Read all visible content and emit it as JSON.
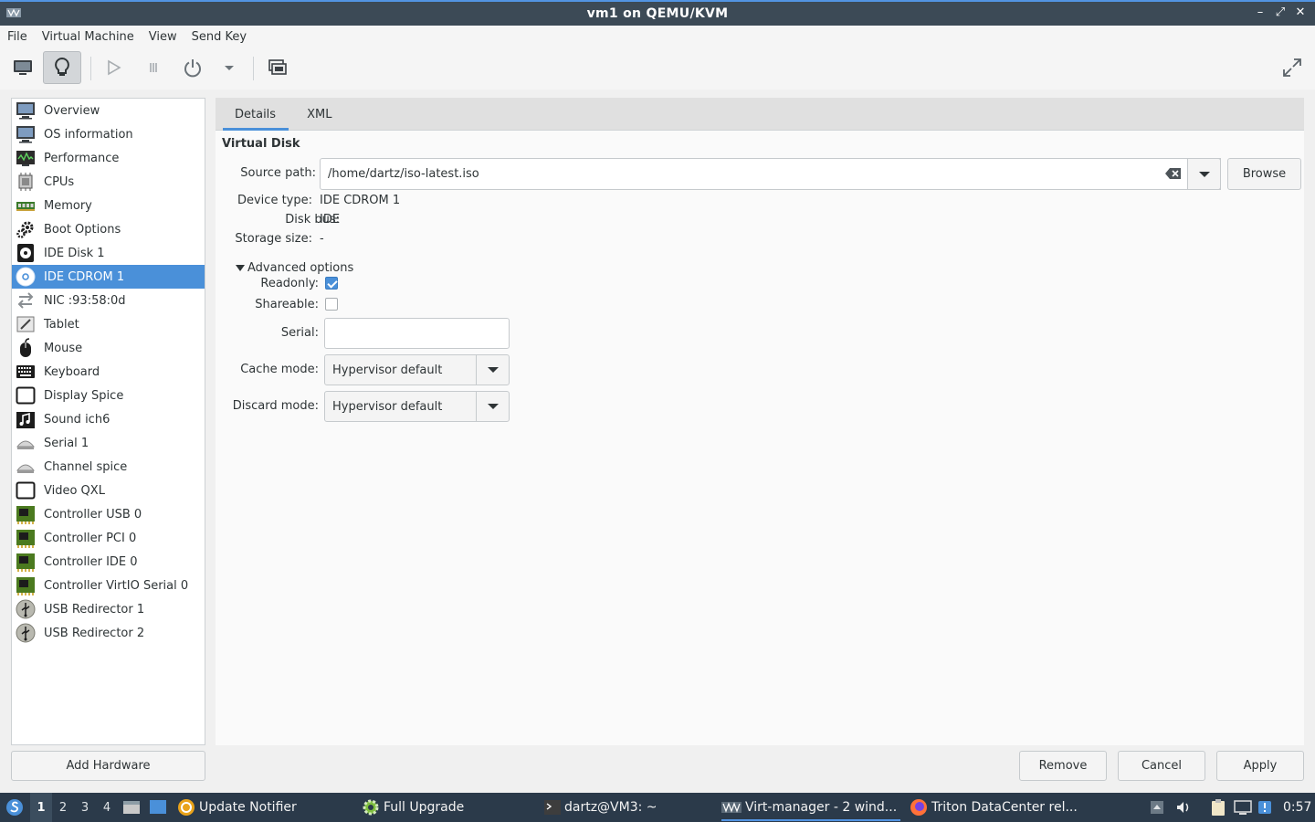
{
  "window": {
    "title": "vm1 on QEMU/KVM"
  },
  "menu": [
    "File",
    "Virtual Machine",
    "View",
    "Send Key"
  ],
  "sidebar": {
    "items": [
      {
        "label": "Overview",
        "icon": "monitor-icon"
      },
      {
        "label": "OS information",
        "icon": "monitor-icon"
      },
      {
        "label": "Performance",
        "icon": "performance-icon"
      },
      {
        "label": "CPUs",
        "icon": "cpu-icon"
      },
      {
        "label": "Memory",
        "icon": "memory-icon"
      },
      {
        "label": "Boot Options",
        "icon": "gears-icon"
      },
      {
        "label": "IDE Disk 1",
        "icon": "disk-icon"
      },
      {
        "label": "IDE CDROM 1",
        "icon": "cdrom-icon",
        "selected": true
      },
      {
        "label": "NIC :93:58:0d",
        "icon": "network-icon"
      },
      {
        "label": "Tablet",
        "icon": "tablet-icon"
      },
      {
        "label": "Mouse",
        "icon": "mouse-icon"
      },
      {
        "label": "Keyboard",
        "icon": "keyboard-icon"
      },
      {
        "label": "Display Spice",
        "icon": "display-icon"
      },
      {
        "label": "Sound ich6",
        "icon": "sound-icon"
      },
      {
        "label": "Serial 1",
        "icon": "serial-icon"
      },
      {
        "label": "Channel spice",
        "icon": "serial-icon"
      },
      {
        "label": "Video QXL",
        "icon": "display-icon"
      },
      {
        "label": "Controller USB 0",
        "icon": "controller-icon"
      },
      {
        "label": "Controller PCI 0",
        "icon": "controller-icon"
      },
      {
        "label": "Controller IDE 0",
        "icon": "controller-icon"
      },
      {
        "label": "Controller VirtIO Serial 0",
        "icon": "controller-icon"
      },
      {
        "label": "USB Redirector 1",
        "icon": "usb-icon"
      },
      {
        "label": "USB Redirector 2",
        "icon": "usb-icon"
      }
    ],
    "add_hardware": "Add Hardware"
  },
  "tabs": [
    "Details",
    "XML"
  ],
  "details": {
    "section_title": "Virtual Disk",
    "source_path_label": "Source path:",
    "source_path_value": "/home/dartz/iso-latest.iso",
    "browse": "Browse",
    "device_type_label": "Device type:",
    "device_type_value": "IDE CDROM 1",
    "disk_bus_label": "Disk bus:",
    "disk_bus_value": "IDE",
    "storage_size_label": "Storage size:",
    "storage_size_value": "-",
    "advanced_label": "Advanced options",
    "readonly_label": "Readonly:",
    "readonly_checked": true,
    "shareable_label": "Shareable:",
    "shareable_checked": false,
    "serial_label": "Serial:",
    "serial_value": "",
    "cache_mode_label": "Cache mode:",
    "cache_mode_value": "Hypervisor default",
    "discard_mode_label": "Discard mode:",
    "discard_mode_value": "Hypervisor default"
  },
  "buttons": {
    "remove": "Remove",
    "cancel": "Cancel",
    "apply": "Apply"
  },
  "taskbar": {
    "workspaces": [
      "1",
      "2",
      "3",
      "4"
    ],
    "current_workspace": "1",
    "tasks": [
      {
        "label": "Update Notifier",
        "icon": "update-notifier-icon"
      },
      {
        "label": "Full Upgrade",
        "icon": "gear-icon"
      },
      {
        "label": "dartz@VM3: ~",
        "icon": "terminal-icon"
      },
      {
        "label": "Virt-manager - 2 wind...",
        "icon": "virt-manager-icon",
        "active": true
      },
      {
        "label": "Triton DataCenter rel...",
        "icon": "firefox-icon"
      }
    ],
    "clock": "0:57"
  },
  "colors": {
    "accent": "#4a90d9",
    "titlebar": "#3c4a56",
    "taskbar": "#2b3a4a"
  }
}
